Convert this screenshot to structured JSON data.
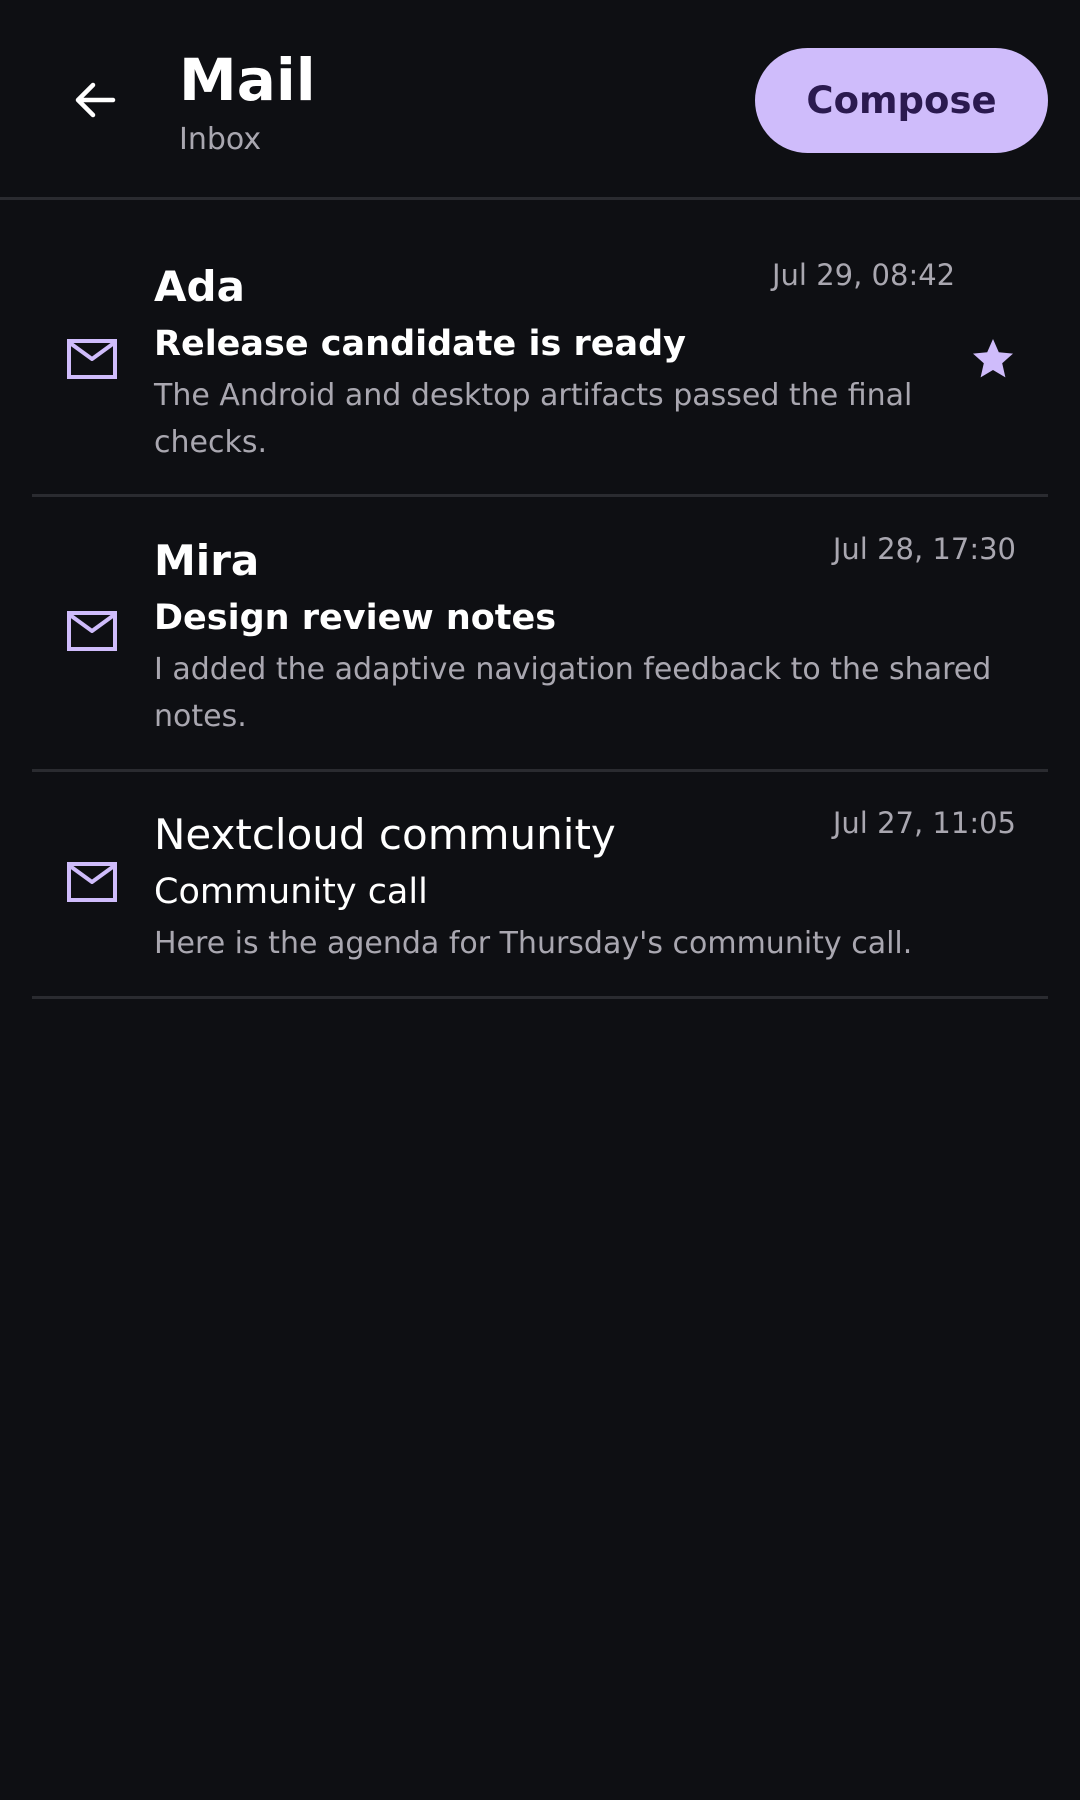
{
  "app_bar": {
    "title": "Mail",
    "subtitle": "Inbox",
    "back_icon": "arrow-back-icon",
    "compose_label": "Compose"
  },
  "colors": {
    "background": "#0e0f13",
    "accent": "#cfbcfb",
    "on_accent": "#2b1a4f",
    "divider": "#2a2b30",
    "secondary_text": "#a9a7b0"
  },
  "messages": [
    {
      "sender": "Ada",
      "date": "Jul 29, 08:42",
      "subject": "Release candidate is ready",
      "preview": "The Android and desktop artifacts passed the final checks.",
      "starred": true,
      "unread": true,
      "icon": "mail-icon"
    },
    {
      "sender": "Mira",
      "date": "Jul 28, 17:30",
      "subject": "Design review notes",
      "preview": "I added the adaptive navigation feedback to the shared notes.",
      "starred": false,
      "unread": true,
      "icon": "mail-icon"
    },
    {
      "sender": "Nextcloud community",
      "date": "Jul 27, 11:05",
      "subject": "Community call",
      "preview": "Here is the agenda for Thursday's community call.",
      "starred": false,
      "unread": false,
      "icon": "mail-icon"
    }
  ]
}
